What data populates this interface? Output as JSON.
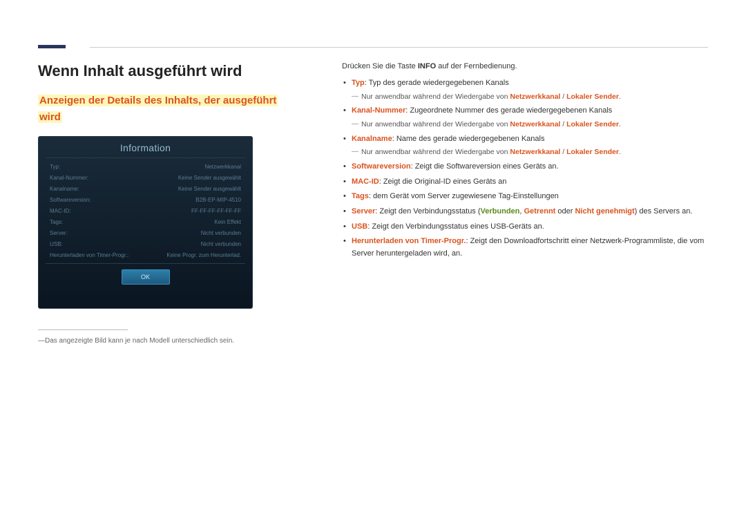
{
  "heading": "Wenn Inhalt ausgeführt wird",
  "subheading": "Anzeigen der Details des Inhalts, der ausgeführt wird",
  "panel": {
    "title": "Information",
    "rows": [
      {
        "label": "Typ:",
        "value": "Netzwerkkanal"
      },
      {
        "label": "Kanal-Nummer:",
        "value": "Keine Sender ausgewählt"
      },
      {
        "label": "Kanalname:",
        "value": "Keine Sender ausgewählt"
      },
      {
        "label": "Softwareversion:",
        "value": "B2B-EP-MIP-4510"
      },
      {
        "label": "MAC-ID:",
        "value": "FF-FF-FF-FF-FF-FF"
      },
      {
        "label": "Tags:",
        "value": "Kein Effekt"
      },
      {
        "label": "Server:",
        "value": "Nicht verbunden"
      },
      {
        "label": "USB:",
        "value": "Nicht verbunden"
      },
      {
        "label": "Herunterladen von Timer-Progr.:",
        "value": "Keine Progr. zum Herunterlad."
      }
    ],
    "ok": "OK"
  },
  "footnote": "Das angezeigte Bild kann je nach Modell unterschiedlich sein.",
  "intro_pre": "Drücken Sie die Taste ",
  "intro_bold": "INFO",
  "intro_post": " auf der Fernbedienung.",
  "items": {
    "typ_term": "Typ",
    "typ_text": ": Typ des gerade wiedergegebenen Kanals",
    "sub_pre": "Nur anwendbar während der Wiedergabe von ",
    "netzwerkkanal": "Netzwerkkanal",
    "sep": " / ",
    "lokaler": "Lokaler Sender",
    "dot": ".",
    "kanalnr_term": "Kanal-Nummer",
    "kanalnr_text": ": Zugeordnete Nummer des gerade wiedergegebenen Kanals",
    "kanalname_term": "Kanalname",
    "kanalname_text": ": Name des gerade wiedergegebenen Kanals",
    "sw_term": "Softwareversion",
    "sw_text": ": Zeigt die Softwareversion eines Geräts an.",
    "mac_term": "MAC-ID",
    "mac_text": ": Zeigt die Original-ID eines Geräts an",
    "tags_term": "Tags",
    "tags_text": ": dem Gerät vom Server zugewiesene Tag-Einstellungen",
    "server_term": "Server",
    "server_pre": ": Zeigt den Verbindungsstatus (",
    "verbunden": "Verbunden",
    "comma": ", ",
    "getrennt": "Getrennt",
    "oder": " oder ",
    "nichtgen": "Nicht genehmigt",
    "server_post": ") des Servers an.",
    "usb_term": "USB",
    "usb_text": ": Zeigt den Verbindungsstatus eines USB-Geräts an.",
    "dl_term": "Herunterladen von Timer-Progr.",
    "dl_text": ": Zeigt den Downloadfortschritt einer Netzwerk-Programmliste, die vom Server heruntergeladen wird, an."
  }
}
